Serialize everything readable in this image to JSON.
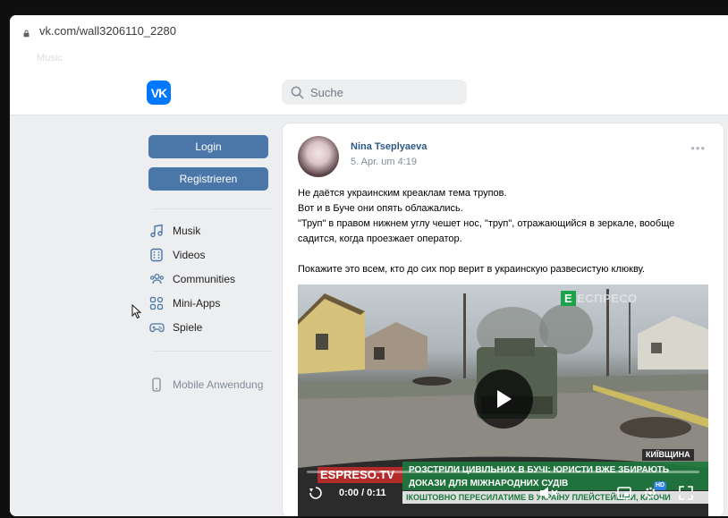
{
  "browser": {
    "url": "vk.com/wall3206110_2280",
    "bookmarks": [
      "Music"
    ]
  },
  "header": {
    "logo_text": "VK",
    "search_placeholder": "Suche"
  },
  "sidebar": {
    "login_label": "Login",
    "register_label": "Registrieren",
    "items": [
      {
        "label": "Musik",
        "icon": "music-icon"
      },
      {
        "label": "Videos",
        "icon": "videos-icon"
      },
      {
        "label": "Communities",
        "icon": "communities-icon"
      },
      {
        "label": "Mini-Apps",
        "icon": "mini-apps-icon"
      },
      {
        "label": "Spiele",
        "icon": "games-icon"
      }
    ],
    "mobile_label": "Mobile Anwendung"
  },
  "post": {
    "author": "Nina Tseplyaeva",
    "date": "5. Apr. um 4:19",
    "paragraph1": "Не даётся украинским креаклам тема трупов.\nВот и в Буче они опять облажались.\n\"Труп\" в правом нижнем углу чешет нос, \"труп\", отражающийся в зеркале, вообще садится, когда проезжает оператор.",
    "paragraph2": "Покажите это всем, кто до сих пор верит в украинскую развесистую клюкву."
  },
  "video": {
    "channel_badge": "ЕСПРЕСО",
    "location_tag": "КИЇВЩИНА",
    "channel_name": "ESPRESO.TV",
    "headline_line1": "РОЗСТРІЛИ ЦИВІЛЬНИХ В БУЧІ: ЮРИСТИ ВЖЕ ЗБИРАЮТЬ",
    "headline_line2": "ДОКАЗИ ДЛЯ МІЖНАРОДНИХ СУДІВ",
    "ticker": "ІКОШТОВНО ПЕРЕСИЛАТИМЕ В УКРАЇНУ ПЛЕЙСТЕЙШНИ, КЛЮЧИ",
    "time": "0:00 / 0:11",
    "quality_badge": "HD",
    "progress": 0.0
  }
}
